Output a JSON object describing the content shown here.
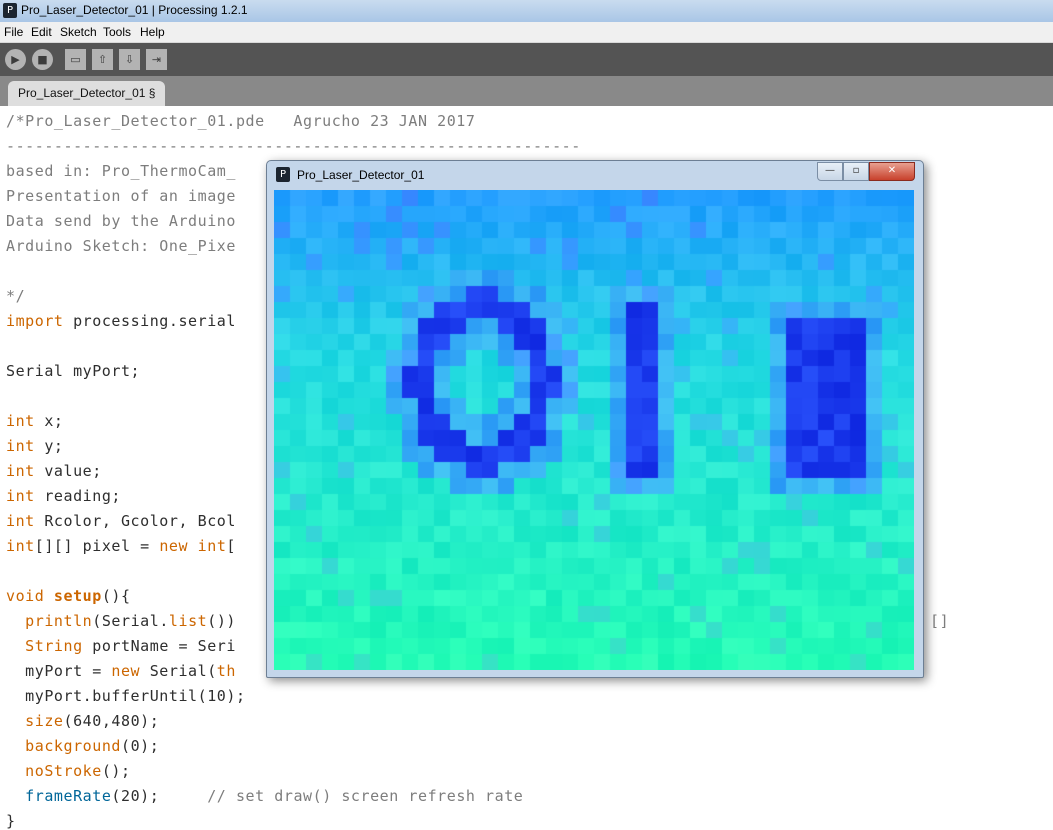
{
  "window": {
    "title": "Pro_Laser_Detector_01 | Processing 1.2.1"
  },
  "menu": [
    "File",
    "Edit",
    "Sketch",
    "Tools",
    "Help"
  ],
  "toolbar": {
    "buttons": [
      "run-icon",
      "stop-icon",
      "new-icon",
      "open-icon",
      "save-icon",
      "export-icon"
    ]
  },
  "tab": {
    "label": "Pro_Laser_Detector_01 §"
  },
  "code": {
    "lines": [
      "/*Pro_Laser_Detector_01.pde   Agrucho 23 JAN 2017",
      "------------------------------------------------------------",
      "based in: Pro_ThermoCam_",
      "Presentation of an image",
      "Data send by the Arduino",
      "Arduino Sketch: One_Pixe",
      "",
      "*/",
      "import processing.serial",
      "",
      "Serial myPort;",
      "",
      "int x;",
      "int y;",
      "int value;",
      "int reading;",
      "int Rcolor, Gcolor, Bcol",
      "int[][] pixel = new int[",
      "",
      "void setup(){",
      "  println(Serial.list())",
      "  String portName = Seri",
      "  myPort = new Serial(th",
      "  myPort.bufferUntil(10);",
      "  size(640,480);",
      "  background(0);",
      "  noStroke();",
      "  frameRate(20);     // set draw() screen refresh rate",
      "}"
    ],
    "partial_right_text": "[]"
  },
  "sketch_window": {
    "title": "Pro_Laser_Detector_01",
    "displayed_characters": [
      "0",
      "1",
      "8"
    ],
    "colors": {
      "background_cyan": "#2ee6f5",
      "background_green": "#1ff2c8",
      "background_blue": "#27b4f5",
      "character_blue": "#1438e6"
    }
  }
}
